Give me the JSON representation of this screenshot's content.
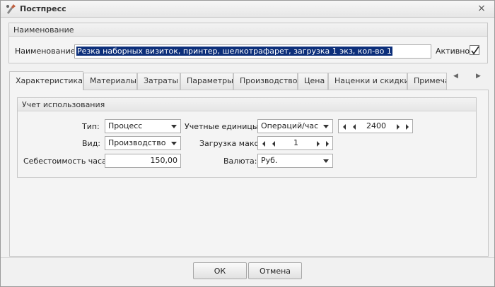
{
  "window": {
    "title": "Постпресс",
    "close_glyph": "×"
  },
  "name_group": {
    "header": "Наименование",
    "name_label": "Наименование:",
    "name_value": "Резка наборных визиток,  принтер, шелкотрафарет, загрузка  1 экз, кол-во 1",
    "active_label": "Активно",
    "active_checked": true
  },
  "tabs": [
    {
      "label": "Характеристика",
      "active": true
    },
    {
      "label": "Материалы"
    },
    {
      "label": "Затраты"
    },
    {
      "label": "Параметры"
    },
    {
      "label": "Производство"
    },
    {
      "label": "Цена"
    },
    {
      "label": "Наценки и скидки"
    },
    {
      "label": "Примечан"
    }
  ],
  "usage": {
    "header": "Учет использования",
    "type_label": "Тип:",
    "type_value": "Процесс",
    "kind_label": "Вид:",
    "kind_value": "Производство",
    "cost_label": "Себестоимость часа:",
    "cost_value": "150,00",
    "units_label": "Учетные единицы:",
    "units_value": "Операций/час",
    "units_spin_value": "2400",
    "load_label": "Загрузка макс:",
    "load_value": "1",
    "currency_label": "Валюта:",
    "currency_value": "Руб."
  },
  "buttons": {
    "ok": "ОК",
    "cancel": "Отмена"
  }
}
